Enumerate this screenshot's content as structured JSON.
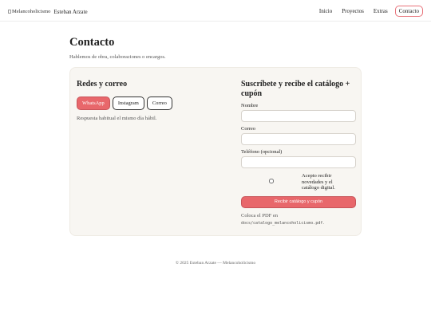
{
  "header": {
    "logo_alt": "Melancoholicismo",
    "brand": "Esteban Arzate",
    "nav": [
      "Inicio",
      "Proyectos",
      "Extras",
      "Contacto"
    ]
  },
  "page": {
    "title": "Contacto",
    "subtitle": "Hablemos de obra, colaboraciones o encargos."
  },
  "left": {
    "title": "Redes y correo",
    "buttons": [
      "WhatsApp",
      "Instagram",
      "Correo"
    ],
    "note": "Respuesta habitual el mismo día hábil."
  },
  "form": {
    "title": "Suscríbete y recibe el catálogo + cupón",
    "fields": {
      "name_label": "Nombre",
      "email_label": "Correo",
      "phone_label": "Teléfono (opcional)"
    },
    "consent_text": "Acepto recibir novedades y el catálogo digital.",
    "submit_label": "Recibir catálogo y cupón",
    "pdf_note": "Coloca el PDF en",
    "pdf_path": "docs/catalogo_melancoholicismo.pdf",
    "pdf_suffix": "."
  },
  "footer": {
    "text": "© 2025 Esteban Arzate — Melancoholicismo"
  },
  "colors": {
    "accent": "#e8676b",
    "card_bg": "#f8f6f2"
  }
}
